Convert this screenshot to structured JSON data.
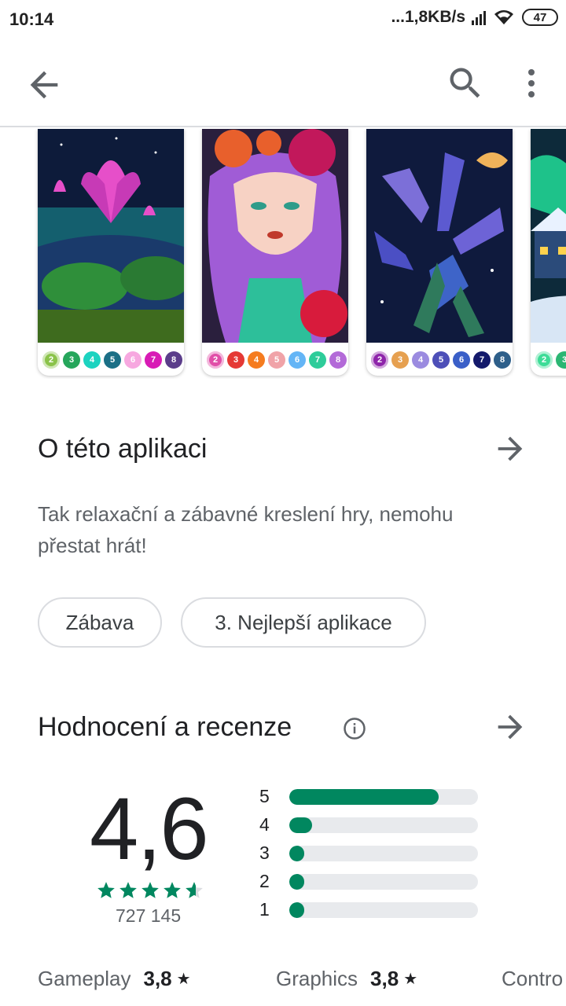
{
  "status_bar": {
    "time": "10:14",
    "net_speed": "...1,8KB/s",
    "battery": "47"
  },
  "app_bar": {
    "back_icon": "arrow-back-icon",
    "search_icon": "search-icon",
    "more_icon": "more-vert-icon"
  },
  "screenshots": [
    {
      "name": "lotus",
      "palette": [
        {
          "n": "2",
          "color": "#8bc34a"
        },
        {
          "n": "3",
          "color": "#26a65b"
        },
        {
          "n": "4",
          "color": "#1dd3c0"
        },
        {
          "n": "5",
          "color": "#1b6f86"
        },
        {
          "n": "6",
          "color": "#f7a8e0"
        },
        {
          "n": "7",
          "color": "#d81bb5"
        },
        {
          "n": "8",
          "color": "#5b3d8a"
        }
      ]
    },
    {
      "name": "girl",
      "palette": [
        {
          "n": "2",
          "color": "#e14fa8"
        },
        {
          "n": "3",
          "color": "#e53935"
        },
        {
          "n": "4",
          "color": "#f57c1f"
        },
        {
          "n": "5",
          "color": "#f0a3a8"
        },
        {
          "n": "6",
          "color": "#64b5f6"
        },
        {
          "n": "7",
          "color": "#2ecc9a"
        },
        {
          "n": "8",
          "color": "#b36ad8"
        }
      ]
    },
    {
      "name": "lilies",
      "palette": [
        {
          "n": "2",
          "color": "#8e24aa"
        },
        {
          "n": "3",
          "color": "#e6a050"
        },
        {
          "n": "4",
          "color": "#9b8be0"
        },
        {
          "n": "5",
          "color": "#4d4fb8"
        },
        {
          "n": "6",
          "color": "#3a5fc8"
        },
        {
          "n": "7",
          "color": "#141a6b"
        },
        {
          "n": "8",
          "color": "#2e5f8a"
        }
      ]
    },
    {
      "name": "winter",
      "palette": [
        {
          "n": "2",
          "color": "#3ddc97"
        },
        {
          "n": "3",
          "color": "#2bb673"
        }
      ]
    }
  ],
  "about": {
    "title": "O této aplikaci",
    "description": "Tak relaxační a zábavné kreslení hry, nemohu přestat hrát!",
    "chips": [
      "Zábava",
      "3. Nejlepší aplikace"
    ]
  },
  "ratings": {
    "title": "Hodnocení a recenze",
    "info_icon": "info-icon",
    "score": "4,6",
    "stars_value": 4.6,
    "review_count": "727 145",
    "accent_color": "#01875f",
    "distribution": [
      {
        "label": "5",
        "fraction": 0.79
      },
      {
        "label": "4",
        "fraction": 0.12
      },
      {
        "label": "3",
        "fraction": 0.04
      },
      {
        "label": "2",
        "fraction": 0.03
      },
      {
        "label": "1",
        "fraction": 0.04
      }
    ],
    "sub_ratings": [
      {
        "label": "Gameplay",
        "value": "3,8",
        "star": "★"
      },
      {
        "label": "Graphics",
        "value": "3,8",
        "star": "★"
      },
      {
        "label": "Contro",
        "value": "",
        "star": ""
      }
    ]
  }
}
